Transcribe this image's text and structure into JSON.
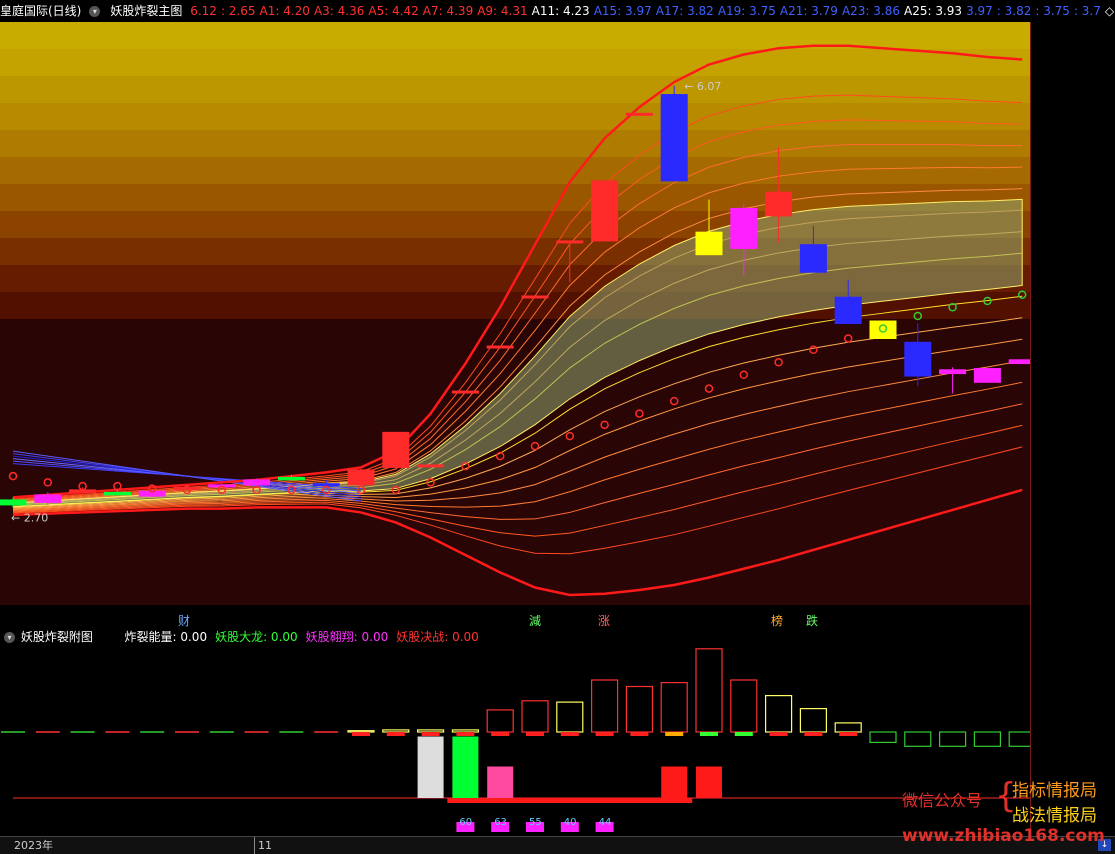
{
  "header": {
    "stock_title": "皇庭国际(日线)",
    "indicator_name": "妖股炸裂主图",
    "values": [
      {
        "text": "6.12",
        "color": "#ff3030"
      },
      {
        "text": ": 2.65",
        "color": "#ff3030"
      },
      {
        "text": "A1: 4.20",
        "color": "#ff3030"
      },
      {
        "text": "A3: 4.36",
        "color": "#ff3030"
      },
      {
        "text": "A5: 4.42",
        "color": "#ff3030"
      },
      {
        "text": "A7: 4.39",
        "color": "#ff3030"
      },
      {
        "text": "A9: 4.31",
        "color": "#ff3030"
      },
      {
        "text": "A11: 4.23",
        "color": "#ffffff"
      },
      {
        "text": "A15: 3.97",
        "color": "#4060ff"
      },
      {
        "text": "A17: 3.82",
        "color": "#4060ff"
      },
      {
        "text": "A19: 3.75",
        "color": "#4060ff"
      },
      {
        "text": "A21: 3.79",
        "color": "#4060ff"
      },
      {
        "text": "A23: 3.86",
        "color": "#4060ff"
      },
      {
        "text": "A25: 3.93",
        "color": "#ffffff"
      },
      {
        "text": "3.97",
        "color": "#4060ff"
      },
      {
        "text": ": 3.82",
        "color": "#4060ff"
      },
      {
        "text": ": 3.75",
        "color": "#4060ff"
      },
      {
        "text": ": 3.7",
        "color": "#4060ff"
      },
      {
        "text": "◇",
        "color": "#ffffff"
      }
    ]
  },
  "price_labels": {
    "high": "6.07",
    "low": "2.70"
  },
  "events": [
    {
      "text": "财",
      "color": "#66aaff"
    },
    {
      "text": "減",
      "color": "#66ff66"
    },
    {
      "text": "涨",
      "color": "#ff6666"
    },
    {
      "text": "榜",
      "color": "#ffaa33"
    },
    {
      "text": "跌",
      "color": "#66ff66"
    }
  ],
  "sub_header": {
    "name": "妖股炸裂附图",
    "items": [
      {
        "label": "炸裂能量",
        "value": "0.00",
        "color": "#ffffff"
      },
      {
        "label": "妖股大龙",
        "value": "0.00",
        "color": "#33ff33"
      },
      {
        "label": "妖股翱翔",
        "value": "0.00",
        "color": "#ff33ff"
      },
      {
        "label": "妖股决战",
        "value": "0.00",
        "color": "#ff3333"
      }
    ]
  },
  "bottom_axis": {
    "year": "2023年",
    "month": "11"
  },
  "watermark": {
    "wechat": "微信公众号",
    "brand1": "指标情报局",
    "brand2": "战法情报局",
    "url": "www.zhibiao168.com"
  },
  "colors": {
    "up": "#ff2a2a",
    "down": "#2a2aff",
    "yellow": "#ffff00",
    "magenta": "#ff20ff",
    "green": "#00ff33",
    "panel_bg": "#2a0505",
    "grid": "#7a1a1a"
  },
  "chart_data": [
    {
      "type": "candlestick",
      "title": "妖股炸裂主图",
      "ylim": [
        2.0,
        6.5
      ],
      "candles": [
        {
          "o": 2.76,
          "c": 2.72,
          "h": 2.78,
          "l": 2.7,
          "color": "#00ff33"
        },
        {
          "o": 2.74,
          "c": 2.8,
          "h": 2.82,
          "l": 2.72,
          "color": "#ff20ff"
        },
        {
          "o": 2.82,
          "c": 2.84,
          "h": 2.86,
          "l": 2.81,
          "color": "#ff2a2a"
        },
        {
          "o": 2.8,
          "c": 2.82,
          "h": 2.85,
          "l": 2.79,
          "color": "#00ff33"
        },
        {
          "o": 2.79,
          "c": 2.83,
          "h": 2.84,
          "l": 2.78,
          "color": "#ff20ff"
        },
        {
          "o": 2.86,
          "c": 2.86,
          "h": 2.88,
          "l": 2.84,
          "color": "#ff2a2a"
        },
        {
          "o": 2.87,
          "c": 2.88,
          "h": 2.89,
          "l": 2.86,
          "color": "#ff20ff"
        },
        {
          "o": 2.88,
          "c": 2.92,
          "h": 2.93,
          "l": 2.88,
          "color": "#ff20ff"
        },
        {
          "o": 2.92,
          "c": 2.94,
          "h": 2.96,
          "l": 2.92,
          "color": "#00ff33"
        },
        {
          "o": 2.88,
          "c": 2.89,
          "h": 2.92,
          "l": 2.87,
          "color": "#2a2aff"
        },
        {
          "o": 2.88,
          "c": 3.0,
          "h": 3.01,
          "l": 2.86,
          "color": "#ff2a2a"
        },
        {
          "o": 3.02,
          "c": 3.3,
          "h": 3.3,
          "l": 3.0,
          "color": "#ff2a2a"
        },
        {
          "o": 3.04,
          "c": 3.04,
          "h": 3.04,
          "l": 3.04,
          "color": "#ff2a2a"
        },
        {
          "o": 3.63,
          "c": 3.63,
          "h": 3.63,
          "l": 3.63,
          "color": "#ff2a2a"
        },
        {
          "o": 3.99,
          "c": 3.99,
          "h": 3.99,
          "l": 3.99,
          "color": "#ff2a2a"
        },
        {
          "o": 4.39,
          "c": 4.39,
          "h": 4.39,
          "l": 4.39,
          "color": "#ff2a2a"
        },
        {
          "o": 4.83,
          "c": 4.83,
          "h": 4.83,
          "l": 4.5,
          "color": "#ff2a2a"
        },
        {
          "o": 4.83,
          "c": 5.31,
          "h": 5.31,
          "l": 4.83,
          "color": "#ff2a2a"
        },
        {
          "o": 5.85,
          "c": 5.85,
          "h": 5.85,
          "l": 5.85,
          "color": "#ff2a2a"
        },
        {
          "o": 6.0,
          "c": 5.31,
          "h": 6.07,
          "l": 5.31,
          "color": "#2a2aff"
        },
        {
          "o": 4.9,
          "c": 4.72,
          "h": 5.16,
          "l": 4.72,
          "color": "#ffff00"
        },
        {
          "o": 5.09,
          "c": 4.77,
          "h": 5.12,
          "l": 4.55,
          "color": "#ff20ff"
        },
        {
          "o": 5.03,
          "c": 5.22,
          "h": 5.58,
          "l": 4.82,
          "color": "#ff2a2a"
        },
        {
          "o": 4.8,
          "c": 4.58,
          "h": 4.95,
          "l": 4.58,
          "color": "#2a2aff"
        },
        {
          "o": 4.38,
          "c": 4.17,
          "h": 4.52,
          "l": 4.17,
          "color": "#2a2aff"
        },
        {
          "o": 4.19,
          "c": 4.05,
          "h": 4.19,
          "l": 4.05,
          "color": "#ffff00"
        },
        {
          "o": 4.02,
          "c": 3.75,
          "h": 4.17,
          "l": 3.67,
          "color": "#2a2aff"
        },
        {
          "o": 3.8,
          "c": 3.77,
          "h": 3.82,
          "l": 3.61,
          "color": "#ff20ff"
        },
        {
          "o": 3.81,
          "c": 3.7,
          "h": 3.81,
          "l": 3.7,
          "color": "#ff20ff"
        },
        {
          "o": 3.88,
          "c": 3.85,
          "h": 3.88,
          "l": 3.85,
          "color": "#ff20ff"
        }
      ],
      "upper_band": [
        2.78,
        2.8,
        2.82,
        2.84,
        2.86,
        2.88,
        2.9,
        2.92,
        2.95,
        2.98,
        3.02,
        3.15,
        3.45,
        3.85,
        4.3,
        4.8,
        5.3,
        5.65,
        5.9,
        6.1,
        6.24,
        6.32,
        6.37,
        6.39,
        6.39,
        6.37,
        6.35,
        6.33,
        6.3,
        6.28
      ],
      "lower_band": [
        2.64,
        2.65,
        2.66,
        2.67,
        2.68,
        2.69,
        2.69,
        2.7,
        2.7,
        2.7,
        2.66,
        2.58,
        2.46,
        2.32,
        2.18,
        2.06,
        2.0,
        2.01,
        2.04,
        2.08,
        2.14,
        2.21,
        2.28,
        2.36,
        2.44,
        2.52,
        2.6,
        2.68,
        2.76,
        2.84
      ],
      "sar_points": [
        2.95,
        2.9,
        2.87,
        2.87,
        2.85,
        2.84,
        2.84,
        2.84,
        2.84,
        2.84,
        2.84,
        2.84,
        2.9,
        3.03,
        3.11,
        3.19,
        3.27,
        3.36,
        3.45,
        3.55,
        3.65,
        3.76,
        3.86,
        3.96,
        4.05,
        null,
        null,
        null,
        null,
        null
      ],
      "sar_green": [
        null,
        null,
        null,
        null,
        null,
        null,
        null,
        null,
        null,
        null,
        null,
        null,
        null,
        null,
        null,
        null,
        null,
        null,
        null,
        null,
        null,
        null,
        null,
        null,
        null,
        4.13,
        4.23,
        4.3,
        4.35,
        4.4
      ]
    },
    {
      "type": "bar",
      "title": "妖股炸裂附图",
      "series": [
        {
          "name": "炸裂能量",
          "values": [
            0,
            0,
            0,
            0,
            0,
            0,
            0,
            0,
            0,
            0,
            0.05,
            0.08,
            0.08,
            0.08,
            0.85,
            1.2,
            1.15,
            2.0,
            1.75,
            1.9,
            3.2,
            2.0,
            1.4,
            0.9,
            0.35,
            -0.4,
            -0.55,
            -0.55,
            -0.55,
            -0.55
          ]
        },
        {
          "name": "妖股大龙",
          "values": [
            0,
            0,
            0,
            0,
            0,
            0,
            0,
            0,
            0,
            0,
            0,
            0,
            2.05,
            2.05,
            1.05,
            0,
            0,
            0,
            0,
            1.05,
            1.05,
            0,
            0,
            0,
            0,
            0,
            0,
            0,
            0,
            0
          ]
        },
        {
          "name": "妖股翱翔",
          "values": [
            null,
            null,
            null,
            null,
            null,
            null,
            null,
            null,
            null,
            null,
            null,
            null,
            null,
            null,
            null,
            null,
            null,
            null,
            null,
            null,
            null,
            null,
            null,
            null,
            null,
            null,
            null,
            null,
            null,
            null
          ]
        },
        {
          "name": "bottom_labels",
          "values": [
            60,
            63,
            55,
            40,
            44
          ]
        }
      ]
    }
  ]
}
